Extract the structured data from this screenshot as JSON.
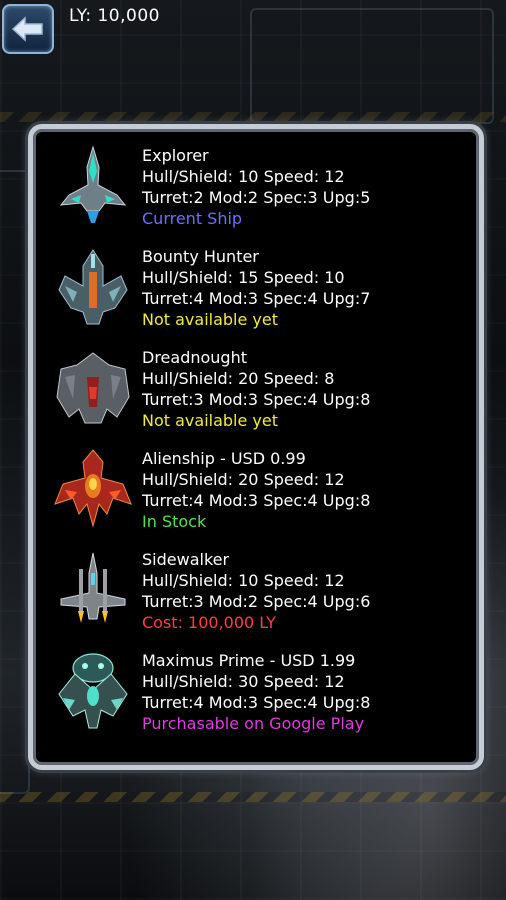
{
  "header": {
    "ly_label": "LY: 10,000"
  },
  "ships": [
    {
      "name": "Explorer",
      "hull_speed": "Hull/Shield: 10 Speed: 12",
      "slots": "Turret:2 Mod:2 Spec:3 Upg:5",
      "status": "Current Ship",
      "status_color": "#6e6eff"
    },
    {
      "name": "Bounty Hunter",
      "hull_speed": "Hull/Shield: 15 Speed: 10",
      "slots": "Turret:4 Mod:3 Spec:4 Upg:7",
      "status": "Not available yet",
      "status_color": "#f0ec3a"
    },
    {
      "name": "Dreadnought",
      "hull_speed": "Hull/Shield: 20 Speed: 8",
      "slots": "Turret:3 Mod:3 Spec:4 Upg:8",
      "status": "Not available yet",
      "status_color": "#f0ec3a"
    },
    {
      "name": "Alienship - USD 0.99",
      "hull_speed": "Hull/Shield: 20 Speed: 12",
      "slots": "Turret:4 Mod:3 Spec:4 Upg:8",
      "status": "In Stock",
      "status_color": "#4fe24f"
    },
    {
      "name": "Sidewalker",
      "hull_speed": "Hull/Shield: 10 Speed: 12",
      "slots": "Turret:3 Mod:2 Spec:4 Upg:6",
      "status": "Cost: 100,000 LY",
      "status_color": "#ff3e3e"
    },
    {
      "name": "Maximus Prime - USD 1.99",
      "hull_speed": "Hull/Shield: 30 Speed: 12",
      "slots": "Turret:4 Mod:3 Spec:4 Upg:8",
      "status": "Purchasable on Google Play",
      "status_color": "#e23ae2"
    }
  ],
  "icons": {
    "back": "back-arrow-icon",
    "ships": [
      "explorer-ship-icon",
      "bounty-hunter-ship-icon",
      "dreadnought-ship-icon",
      "alienship-ship-icon",
      "sidewalker-ship-icon",
      "maximus-prime-ship-icon"
    ]
  }
}
